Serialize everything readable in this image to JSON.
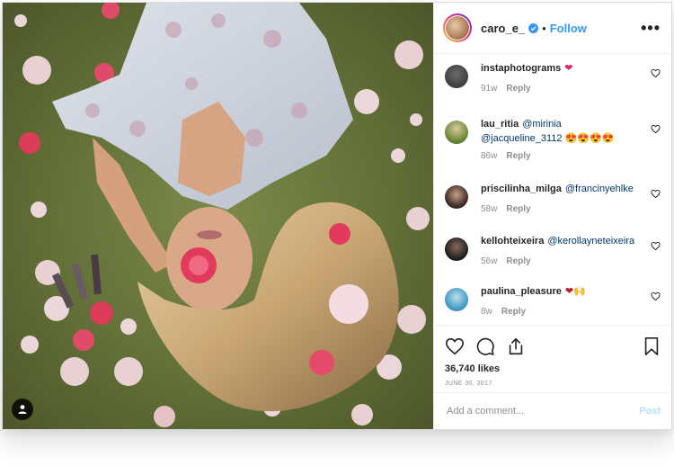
{
  "post": {
    "username": "caro_e_",
    "separator": "•",
    "follow_label": "Follow",
    "more_label": "•••",
    "likes": "36,740 likes",
    "date": "JUNE 30, 2017"
  },
  "comments": [
    {
      "user": "instaphotograms",
      "text": "",
      "emoji": "❤",
      "time": "91w",
      "reply": "Reply",
      "avatar_color": "#2b2b2b"
    },
    {
      "user": "lau_ritia",
      "text": "@mirinia @jacqueline_3112",
      "emoji": "😍😍😍😍",
      "time": "86w",
      "reply": "Reply",
      "avatar_color": "#6f8f3a"
    },
    {
      "user": "priscilinha_milga",
      "text": "@francinyehlke",
      "emoji": "",
      "time": "58w",
      "reply": "Reply",
      "avatar_color": "#3b2a22"
    },
    {
      "user": "kellohteixeira",
      "text": "@kerollayneteixeira",
      "emoji": "",
      "time": "56w",
      "reply": "Reply",
      "avatar_color": "#1f1f1f"
    },
    {
      "user": "paulina_pleasure",
      "text": "",
      "emoji": "❤🙌",
      "time": "8w",
      "reply": "Reply",
      "avatar_color": "#4aa0c9"
    }
  ],
  "add_comment": {
    "placeholder": "Add a comment...",
    "post_label": "Post"
  },
  "colors": {
    "accent": "#3897f0",
    "post_disabled": "#b2dffc",
    "secondary_text": "#8e8e8e"
  },
  "icons": [
    "verified-badge-icon",
    "more-options-icon",
    "heart-icon",
    "comment-icon",
    "share-icon",
    "bookmark-icon",
    "user-tag-icon"
  ]
}
